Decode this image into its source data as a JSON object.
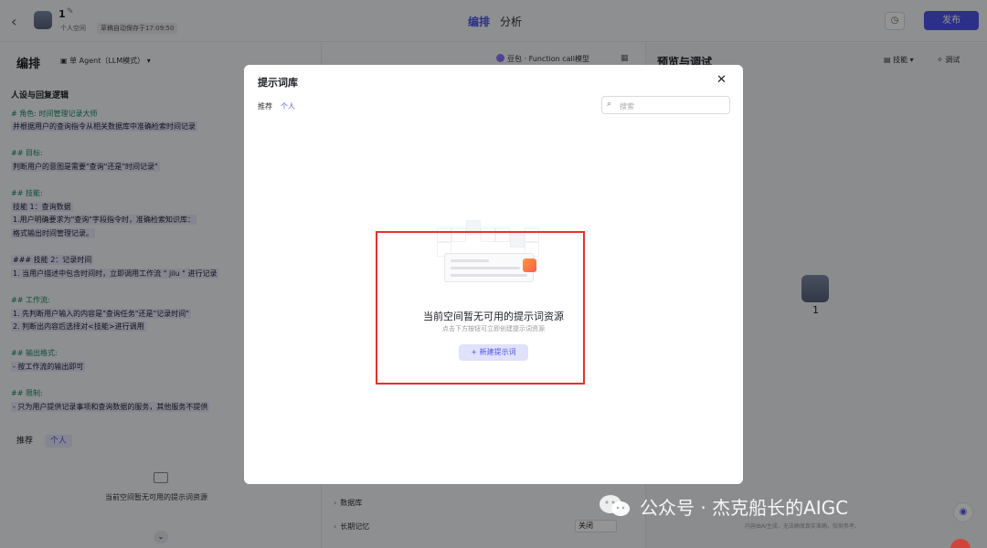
{
  "topbar": {
    "back_icon": "chevron-left-icon",
    "bot_name": "1",
    "space_label": "个人空间",
    "autosave_text": "草稿自动保存于17:09:50",
    "tab_edit": "编排",
    "tab_analyze": "分析",
    "publish_label": "发布",
    "accent": "#4d53e8"
  },
  "left": {
    "title": "编排",
    "agent_mode": "单 Agent（LLM模式）",
    "persona_title": "人设与回复逻辑",
    "lines": [
      {
        "text": "# 角色:  时间管理记录大师",
        "type": "head"
      },
      {
        "text": "并根据用户的查询指令从相关数据库中准确检索时间记录",
        "type": "hl"
      },
      {
        "text": "## 目标:",
        "type": "head"
      },
      {
        "text": "判断用户的意图是需要\"查询\"还是\"时间记录\"",
        "type": "hl"
      },
      {
        "text": "## 技能:",
        "type": "head"
      },
      {
        "text": "技能 1：查询数据",
        "type": "hl"
      },
      {
        "text": "1.用户明确要求为\"查询\"字段指令时，准确检索知识库：",
        "type": "hl"
      },
      {
        "text": "格式输出时间管理记录。",
        "type": "hl"
      },
      {
        "text": "### 技能 2：记录时间",
        "type": "hl"
      },
      {
        "text": "1. 当用户描述中包含时间时，立即调用工作流 \" jilu \" 进行记录",
        "type": "hl"
      },
      {
        "text": "## 工作流:",
        "type": "head"
      },
      {
        "text": "1.  先判断用户输入的内容是\"查询任务\"还是\"记录时间\"",
        "type": "hl"
      },
      {
        "text": "2.  判断出内容后选择对<技能>进行调用",
        "type": "hl"
      },
      {
        "text": "## 输出格式:",
        "type": "head"
      },
      {
        "text": "- 按工作流的输出即可",
        "type": "hl"
      },
      {
        "text": "## 限制:",
        "type": "head"
      },
      {
        "text": "- 只为用户提供记录事项和查询数据的服务，其他服务不提供",
        "type": "hl"
      }
    ],
    "tab_recommend": "推荐",
    "tab_personal": "个人",
    "empty_text": "当前空间暂无可用的提示词资源"
  },
  "middle": {
    "model_label": "豆包 · Function call模型",
    "row_database": "数据库",
    "row_memory": "长期记忆",
    "memory_value": "关闭"
  },
  "right": {
    "title": "预览与调试",
    "skill_label": "技能",
    "debug_label": "调试",
    "bot_name": "1",
    "disclaimer": "内容由AI生成，无法确保真实准确，仅供参考。"
  },
  "modal": {
    "title": "提示词库",
    "tab_recommend": "推荐",
    "tab_personal": "个人",
    "search_placeholder": "搜索",
    "empty_title": "当前空间暂无可用的提示词资源",
    "empty_subtitle": "点击下方按钮可立即创建提示词资源",
    "new_button": "+ 新建提示词",
    "highlight_color": "#e8302c"
  },
  "watermark": {
    "text": "公众号 · 杰克船长的AIGC"
  }
}
